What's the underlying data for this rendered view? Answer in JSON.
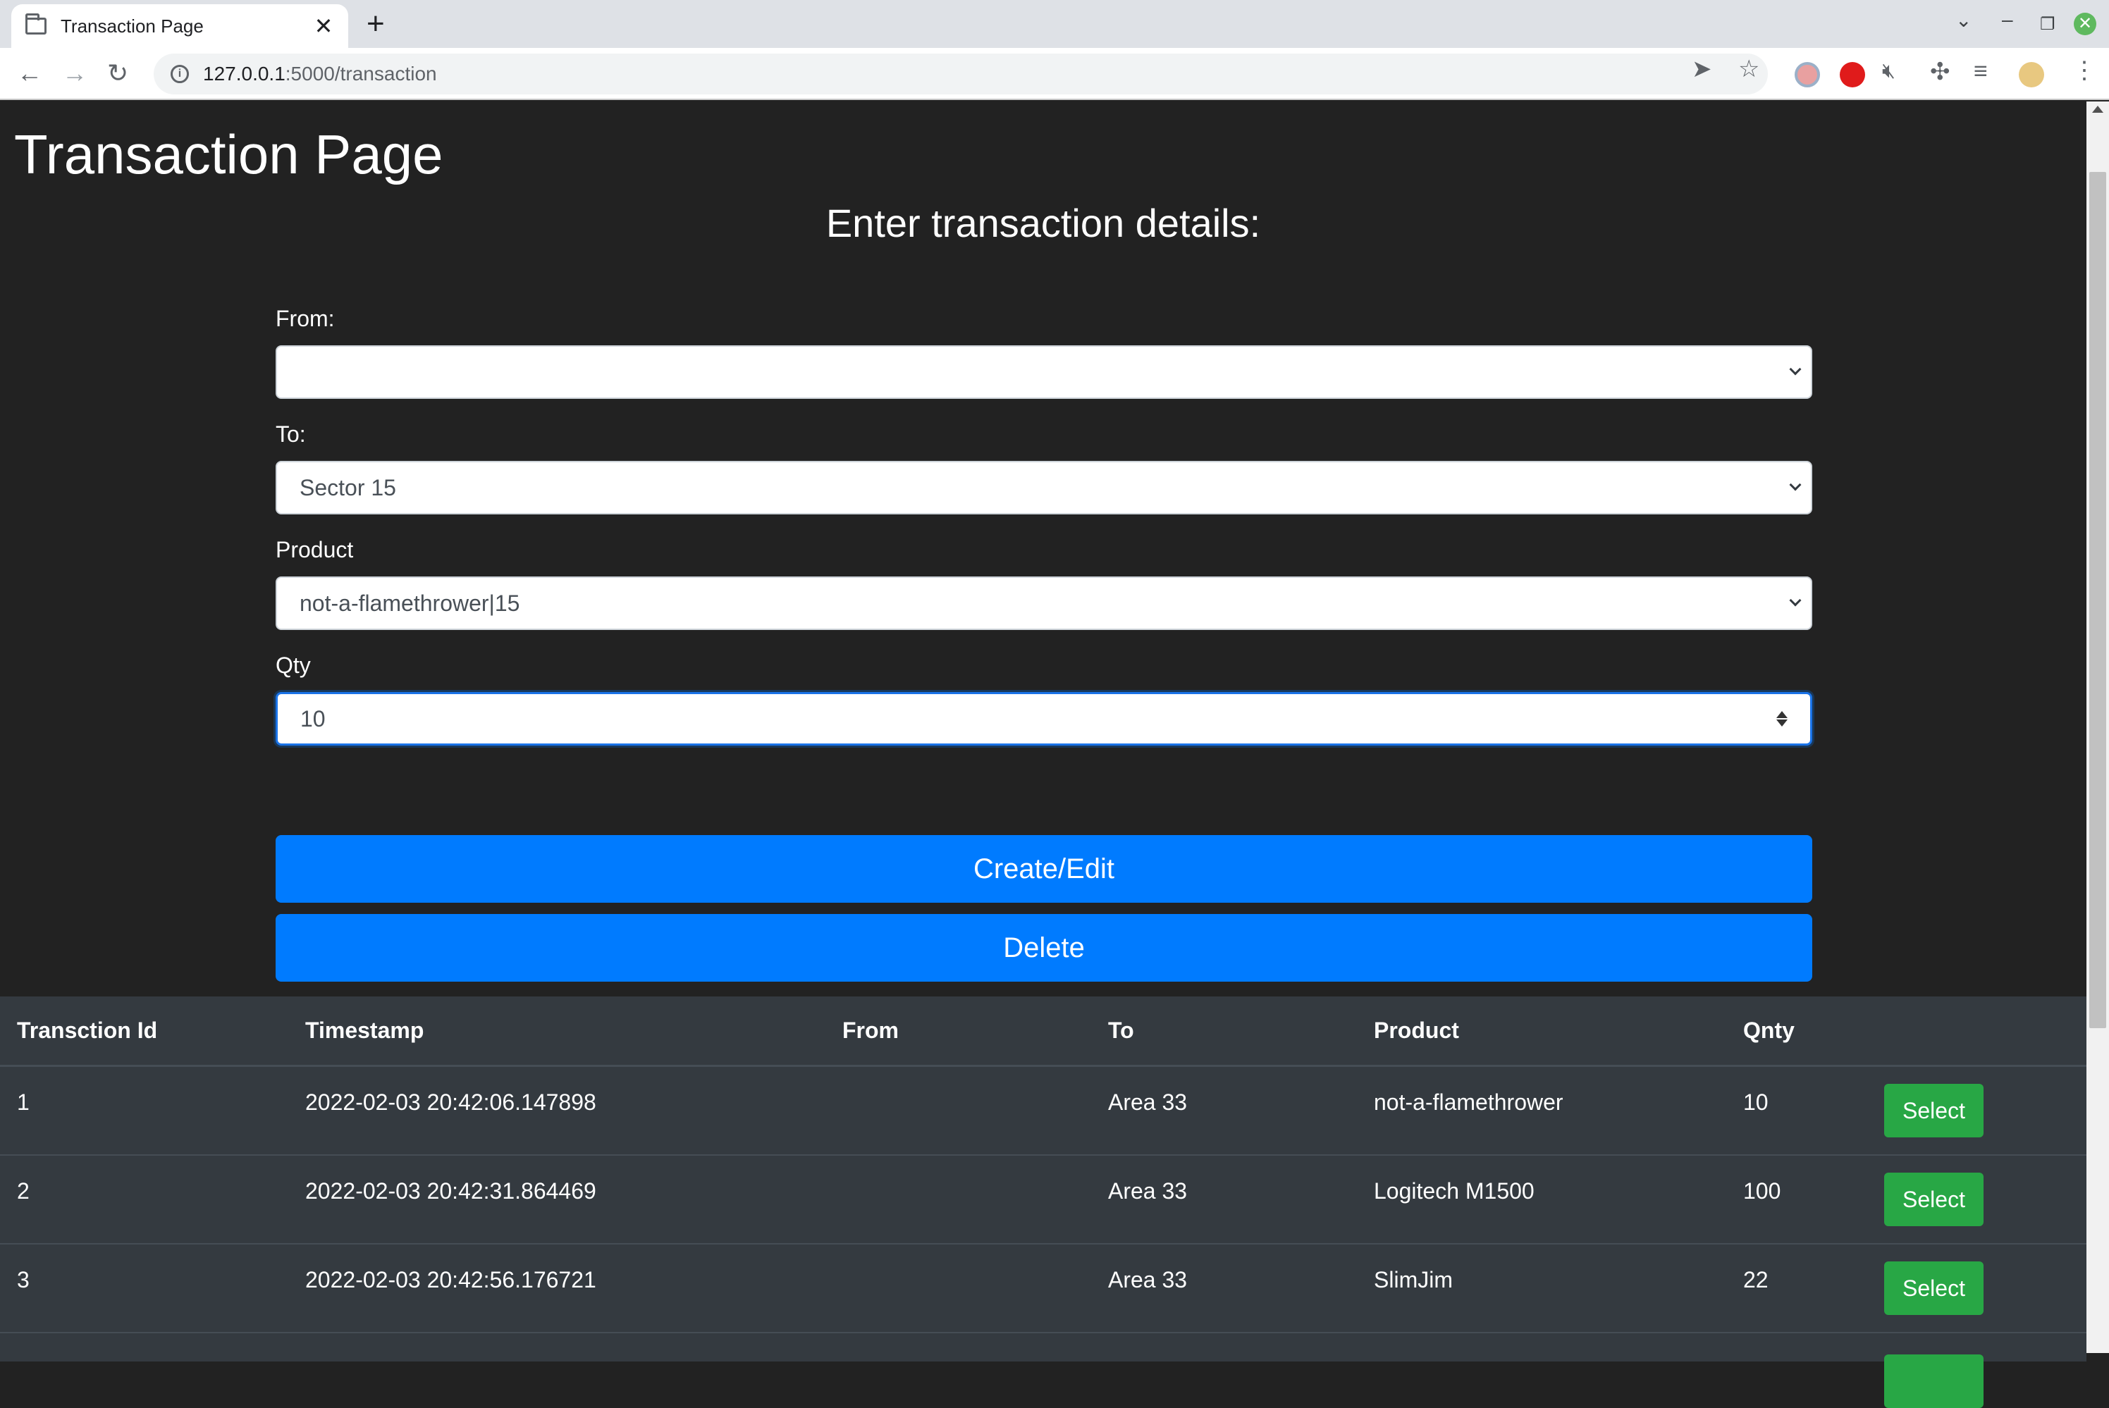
{
  "browser": {
    "tab_title": "Transaction Page",
    "url_host": "127.0.0.1",
    "url_path": ":5000/transaction"
  },
  "page": {
    "title": "Transaction Page",
    "subtitle": "Enter transaction details:"
  },
  "form": {
    "from_label": "From:",
    "from_value": "",
    "to_label": "To:",
    "to_value": "Sector 15",
    "product_label": "Product",
    "product_value": "not-a-flamethrower|15",
    "qty_label": "Qty",
    "qty_value": "10",
    "create_label": "Create/Edit",
    "delete_label": "Delete"
  },
  "table": {
    "headers": [
      "Transction Id",
      "Timestamp",
      "From",
      "To",
      "Product",
      "Qnty"
    ],
    "rows": [
      {
        "id": "1",
        "timestamp": "2022-02-03 20:42:06.147898",
        "from": "",
        "to": "Area 33",
        "product": "not-a-flamethrower",
        "qty": "10",
        "action": "Select"
      },
      {
        "id": "2",
        "timestamp": "2022-02-03 20:42:31.864469",
        "from": "",
        "to": "Area 33",
        "product": "Logitech M1500",
        "qty": "100",
        "action": "Select"
      },
      {
        "id": "3",
        "timestamp": "2022-02-03 20:42:56.176721",
        "from": "",
        "to": "Area 33",
        "product": "SlimJim",
        "qty": "22",
        "action": "Select"
      }
    ]
  },
  "colors": {
    "page_bg": "#222222",
    "primary": "#007bff",
    "success": "#28a745",
    "table_bg": "#343a40"
  }
}
